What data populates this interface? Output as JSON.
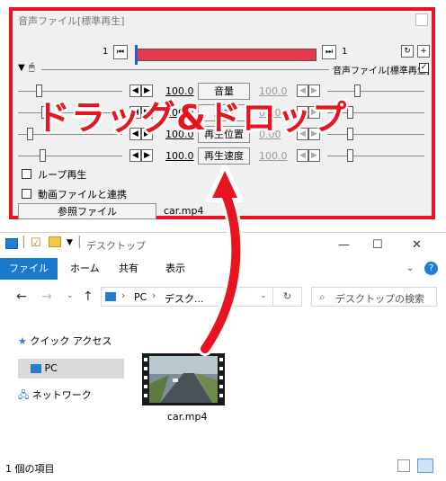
{
  "dialog": {
    "title": "音声ファイル[標準再生]",
    "pos_left": "1",
    "pos_right": "1",
    "layer_label": "音声ファイル[標準再生]",
    "params": [
      {
        "value": "100.0",
        "label": "音量",
        "right_value": "100.0"
      },
      {
        "value": "100.0",
        "label": "左右",
        "right_value": "0.00"
      },
      {
        "value": "100.0",
        "label": "再生位置",
        "right_value": "0.00"
      },
      {
        "value": "100.0",
        "label": "再生速度",
        "right_value": "100.0"
      }
    ],
    "loop_label": "ループ再生",
    "link_label": "動画ファイルと連携",
    "ref_button": "参照ファイル",
    "ref_file": "car.mp4"
  },
  "overlay": {
    "text": "ドラッグ&ドロップ",
    "color": "#e8141f"
  },
  "explorer": {
    "title": "デスクトップ",
    "tabs": {
      "file": "ファイル",
      "home": "ホーム",
      "share": "共有",
      "view": "表示"
    },
    "path": {
      "pc": "PC",
      "desktop": "デスク..."
    },
    "search_placeholder": "デスクトップの検索",
    "nav": {
      "quick": "クイック アクセス",
      "pc": "PC",
      "network": "ネットワーク"
    },
    "file_name": "car.mp4",
    "status": "1 個の項目"
  },
  "colors": {
    "accent_red": "#e81322",
    "ribbon_blue": "#1979ca"
  }
}
